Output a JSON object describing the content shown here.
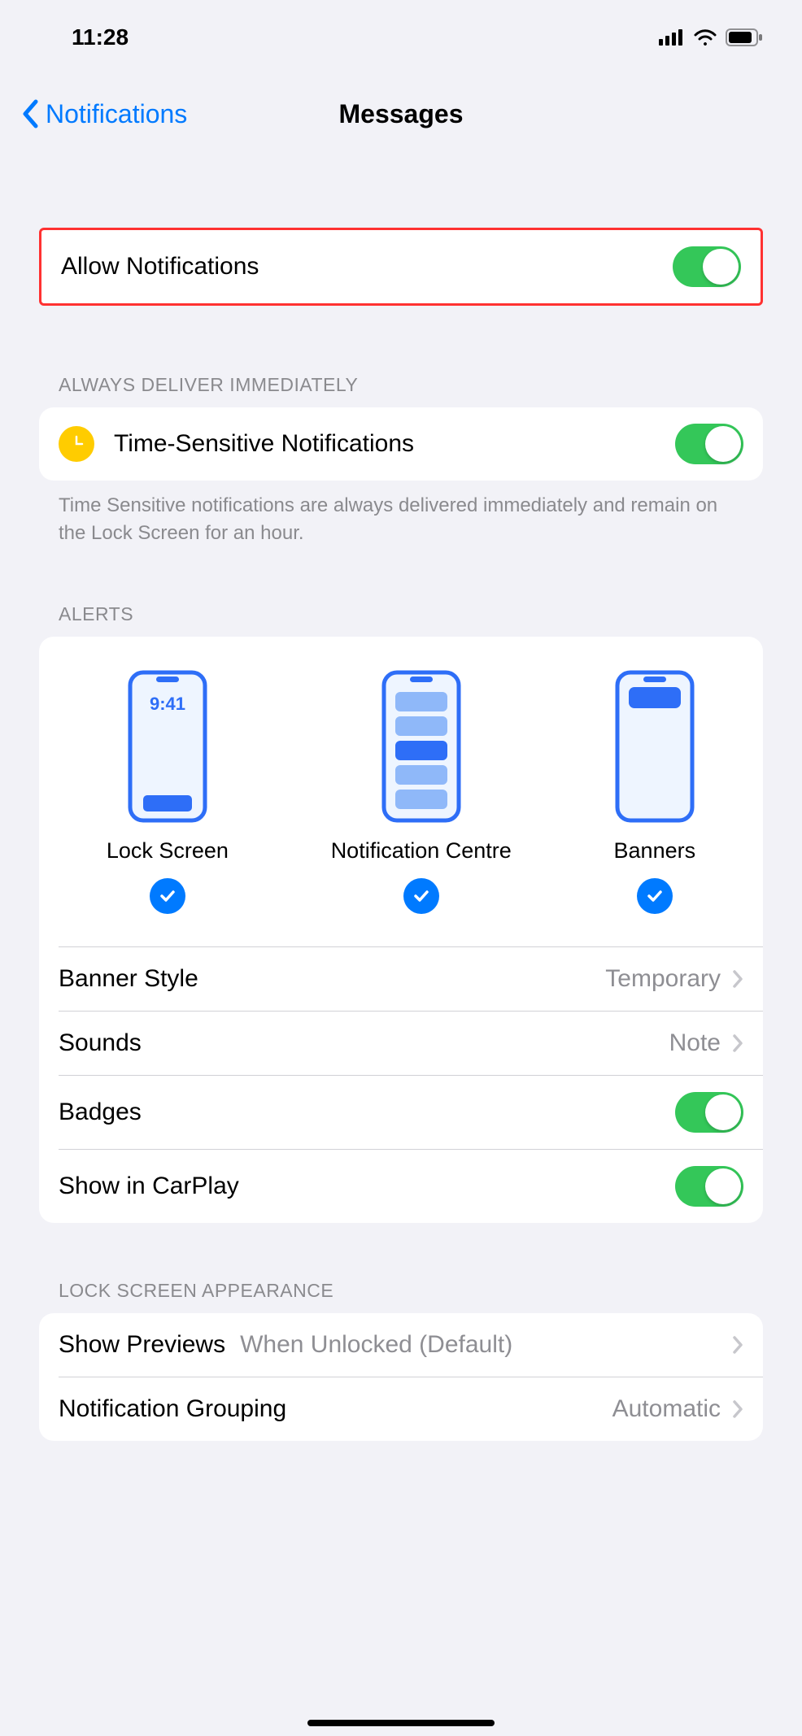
{
  "status": {
    "time": "11:28"
  },
  "nav": {
    "back_label": "Notifications",
    "title": "Messages"
  },
  "allow": {
    "label": "Allow Notifications",
    "on": true
  },
  "section_immediate": {
    "header": "ALWAYS DELIVER IMMEDIATELY",
    "row_label": "Time-Sensitive Notifications",
    "on": true,
    "footer": "Time Sensitive notifications are always delivered immediately and remain on the Lock Screen for an hour."
  },
  "alerts": {
    "header": "ALERTS",
    "options": [
      {
        "label": "Lock Screen",
        "phone_time": "9:41",
        "checked": true
      },
      {
        "label": "Notification Centre",
        "checked": true
      },
      {
        "label": "Banners",
        "checked": true
      }
    ],
    "banner_style": {
      "label": "Banner Style",
      "value": "Temporary"
    },
    "sounds": {
      "label": "Sounds",
      "value": "Note"
    },
    "badges": {
      "label": "Badges",
      "on": true
    },
    "carplay": {
      "label": "Show in CarPlay",
      "on": true
    }
  },
  "lockscreen": {
    "header": "LOCK SCREEN APPEARANCE",
    "previews": {
      "label": "Show Previews",
      "value": "When Unlocked (Default)"
    },
    "grouping": {
      "label": "Notification Grouping",
      "value": "Automatic"
    }
  }
}
